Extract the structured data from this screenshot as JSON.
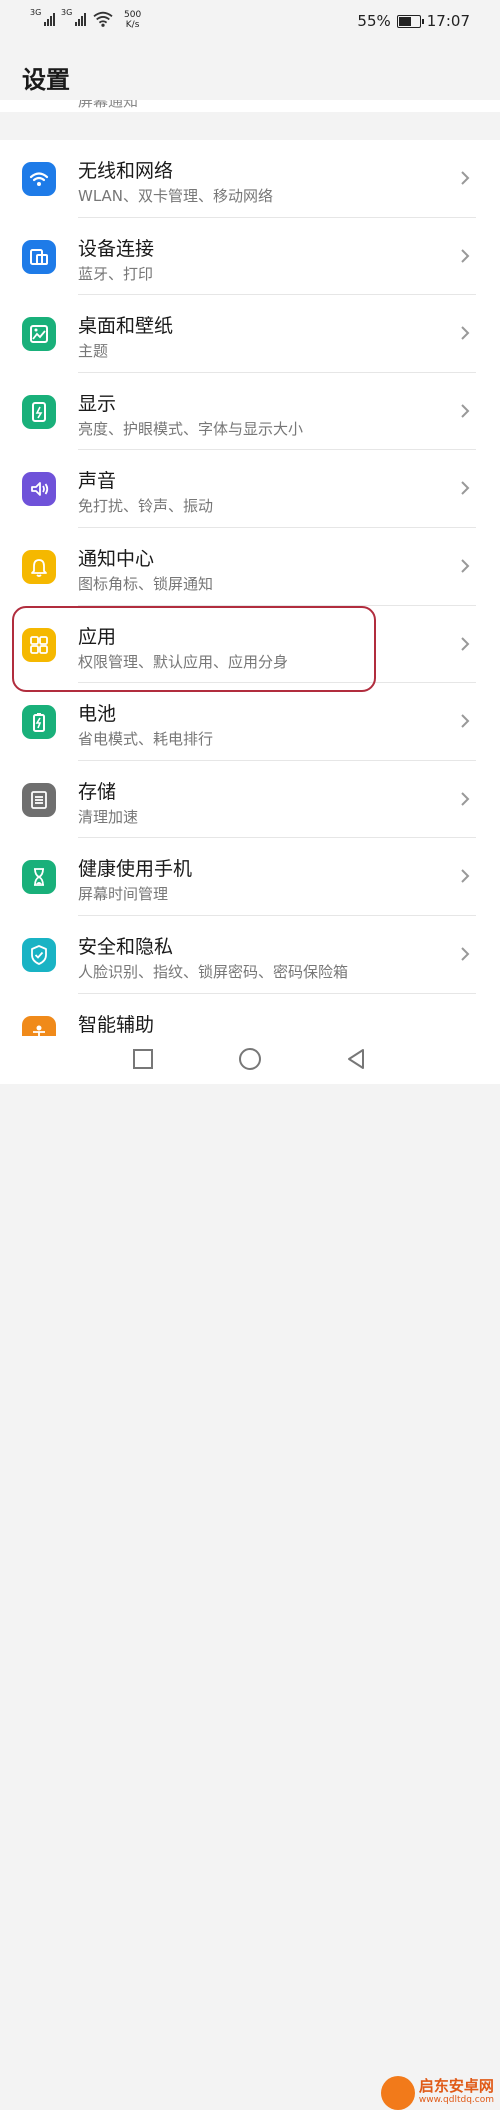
{
  "status": {
    "network1": "3G",
    "network2": "3G",
    "speed_value": "500",
    "speed_unit": "K/s",
    "battery_percent": "55%",
    "battery_level": 0.55,
    "time": "17:07"
  },
  "header": {
    "title": "设置"
  },
  "partial_item_text": "屏幕通知",
  "items": [
    {
      "title": "无线和网络",
      "sub": "WLAN、双卡管理、移动网络",
      "icon": "wifi-icon",
      "color": "#1e7be8"
    },
    {
      "title": "设备连接",
      "sub": "蓝牙、打印",
      "icon": "device-connection-icon",
      "color": "#1e7be8"
    },
    {
      "title": "桌面和壁纸",
      "sub": "主题",
      "icon": "wallpaper-icon",
      "color": "#19b07a"
    },
    {
      "title": "显示",
      "sub": "亮度、护眼模式、字体与显示大小",
      "icon": "display-icon",
      "color": "#19b07a"
    },
    {
      "title": "声音",
      "sub": "免打扰、铃声、振动",
      "icon": "sound-icon",
      "color": "#6f52d9"
    },
    {
      "title": "通知中心",
      "sub": "图标角标、锁屏通知",
      "icon": "bell-icon",
      "color": "#f5b800"
    },
    {
      "title": "应用",
      "sub": "权限管理、默认应用、应用分身",
      "icon": "apps-grid-icon",
      "color": "#f5b800"
    },
    {
      "title": "电池",
      "sub": "省电模式、耗电排行",
      "icon": "battery-icon",
      "color": "#19b07a"
    },
    {
      "title": "存储",
      "sub": "清理加速",
      "icon": "storage-icon",
      "color": "#6f6f6f"
    },
    {
      "title": "健康使用手机",
      "sub": "屏幕时间管理",
      "icon": "hourglass-icon",
      "color": "#19b07a"
    },
    {
      "title": "安全和隐私",
      "sub": "人脸识别、指纹、锁屏密码、密码保险箱",
      "icon": "shield-icon",
      "color": "#19b3c4"
    },
    {
      "title": "智能辅助",
      "sub": "",
      "icon": "assist-icon",
      "color": "#f08a1a"
    }
  ],
  "watermark": {
    "name": "启东安卓网",
    "url": "www.qdltdq.com"
  }
}
